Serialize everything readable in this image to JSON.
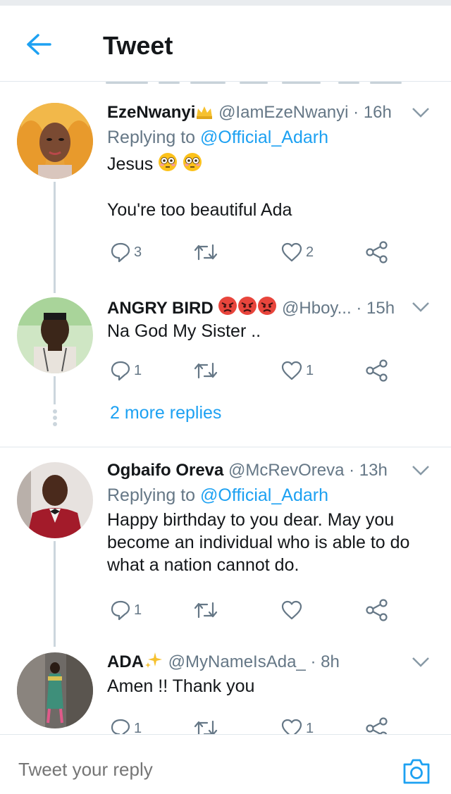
{
  "header": {
    "title": "Tweet",
    "back_icon": "arrow-left-icon"
  },
  "colors": {
    "accent": "#1da1f2",
    "secondary_text": "#657786",
    "primary_text": "#14171a",
    "divider": "#e1e8ed"
  },
  "tweets": [
    {
      "name": "EzeNwanyi",
      "name_emoji": "crown",
      "handle": "@IamEzeNwanyi",
      "time": "16h",
      "replying_prefix": "Replying to",
      "replying_to": "@Official_Adarh",
      "text_line1": "Jesus",
      "text_emoji": "flushed-face flushed-face",
      "text_line2": "You're too beautiful Ada",
      "reply_count": "3",
      "retweet_count": "",
      "like_count": "2"
    },
    {
      "name": "ANGRY BIRD",
      "name_emoji": "angry-face angry-face angry-face",
      "handle": "@Hboy...",
      "time": "15h",
      "text": "Na God My Sister ..",
      "reply_count": "1",
      "retweet_count": "",
      "like_count": "1"
    },
    {
      "name": "Ogbaifo Oreva",
      "handle": "@McRevOreva",
      "time": "13h",
      "replying_prefix": "Replying to",
      "replying_to": "@Official_Adarh",
      "text": "Happy birthday to you dear. May you become an individual who is able to do what a nation cannot do.",
      "reply_count": "1",
      "retweet_count": "",
      "like_count": ""
    },
    {
      "name": "ADA",
      "name_emoji": "sparkles",
      "handle": "@MyNameIsAda_",
      "time": "8h",
      "text": "Amen !! Thank you",
      "reply_count": "1",
      "retweet_count": "",
      "like_count": "1"
    }
  ],
  "more_replies": "2 more replies",
  "compose": {
    "placeholder": "Tweet your reply",
    "camera_icon": "camera-icon"
  }
}
